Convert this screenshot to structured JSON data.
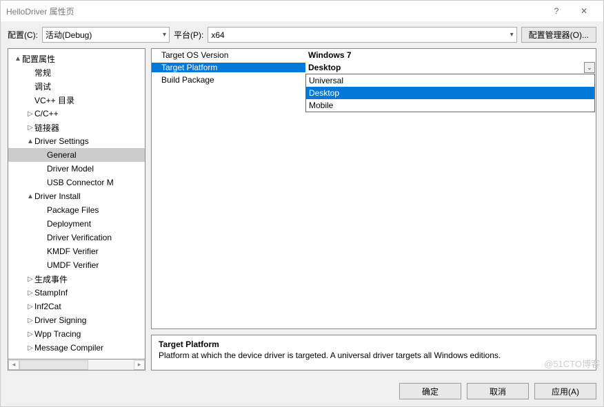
{
  "title": "HelloDriver 属性页",
  "help_glyph": "?",
  "close_glyph": "✕",
  "topbar": {
    "config_label": "配置(C):",
    "config_value": "活动(Debug)",
    "platform_label": "平台(P):",
    "platform_value": "x64",
    "manager_button": "配置管理器(O)..."
  },
  "tree": [
    {
      "label": "配置属性",
      "depth": 0,
      "exp": "▲"
    },
    {
      "label": "常规",
      "depth": 1,
      "exp": ""
    },
    {
      "label": "调试",
      "depth": 1,
      "exp": ""
    },
    {
      "label": "VC++ 目录",
      "depth": 1,
      "exp": ""
    },
    {
      "label": "C/C++",
      "depth": 1,
      "exp": "▷"
    },
    {
      "label": "链接器",
      "depth": 1,
      "exp": "▷"
    },
    {
      "label": "Driver Settings",
      "depth": 1,
      "exp": "▲"
    },
    {
      "label": "General",
      "depth": 2,
      "exp": "",
      "sel": true
    },
    {
      "label": "Driver Model",
      "depth": 2,
      "exp": ""
    },
    {
      "label": "USB Connector M",
      "depth": 2,
      "exp": ""
    },
    {
      "label": "Driver Install",
      "depth": 1,
      "exp": "▲"
    },
    {
      "label": "Package Files",
      "depth": 2,
      "exp": ""
    },
    {
      "label": "Deployment",
      "depth": 2,
      "exp": ""
    },
    {
      "label": "Driver Verification",
      "depth": 2,
      "exp": ""
    },
    {
      "label": "KMDF Verifier",
      "depth": 2,
      "exp": ""
    },
    {
      "label": "UMDF Verifier",
      "depth": 2,
      "exp": ""
    },
    {
      "label": "生成事件",
      "depth": 1,
      "exp": "▷"
    },
    {
      "label": "StampInf",
      "depth": 1,
      "exp": "▷"
    },
    {
      "label": "Inf2Cat",
      "depth": 1,
      "exp": "▷"
    },
    {
      "label": "Driver Signing",
      "depth": 1,
      "exp": "▷"
    },
    {
      "label": "Wpp Tracing",
      "depth": 1,
      "exp": "▷"
    },
    {
      "label": "Message Compiler",
      "depth": 1,
      "exp": "▷"
    }
  ],
  "grid": {
    "rows": [
      {
        "label": "Target OS Version",
        "value": "Windows 7",
        "bold": true
      },
      {
        "label": "Target Platform",
        "value": "Desktop",
        "selected": true
      },
      {
        "label": "Build Package",
        "value": ""
      }
    ],
    "dropdown_options": [
      "Universal",
      "Desktop",
      "Mobile"
    ],
    "dropdown_highlight": 1
  },
  "description": {
    "title": "Target Platform",
    "text": "Platform at which the device driver is targeted. A universal driver targets all Windows editions."
  },
  "footer": {
    "ok": "确定",
    "cancel": "取消",
    "apply": "应用(A)"
  },
  "watermark": "@51CTO博客"
}
